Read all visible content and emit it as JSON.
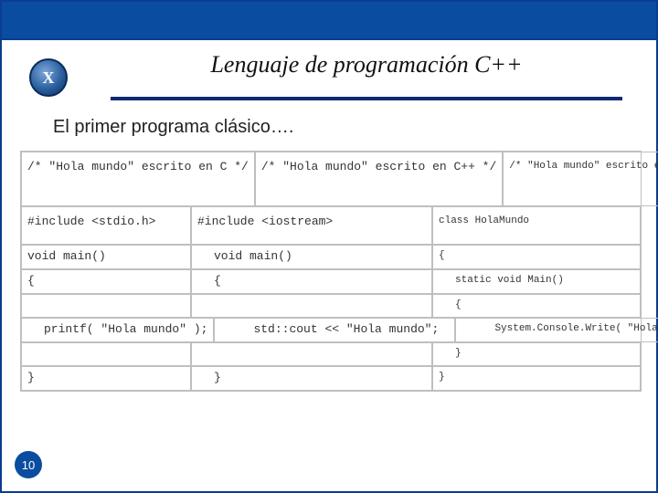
{
  "logo_letter": "X",
  "title": "Lenguaje de programación C++",
  "subtitle": "El primer programa clásico….",
  "page_number": "10",
  "columns": {
    "c": {
      "comment": "/* \"Hola mundo\" escrito en C */",
      "include": "#include <stdio.h>",
      "main": "void main()",
      "open": "{",
      "body": "printf( \"Hola mundo\" );",
      "close": "}"
    },
    "cpp": {
      "comment": "/* \"Hola mundo\" escrito en C++ */",
      "include": "#include <iostream>",
      "main": "void main()",
      "open": "{",
      "body": "std::cout << \"Hola mundo\";",
      "close": "}"
    },
    "cs": {
      "comment": "/* \"Hola mundo\" escrito en C# */",
      "class": "class HolaMundo",
      "class_open": "{",
      "main": "static void Main()",
      "open": "{",
      "body": "System.Console.Write( \"Hola mundo\" );",
      "close": "}",
      "class_close": "}"
    }
  }
}
